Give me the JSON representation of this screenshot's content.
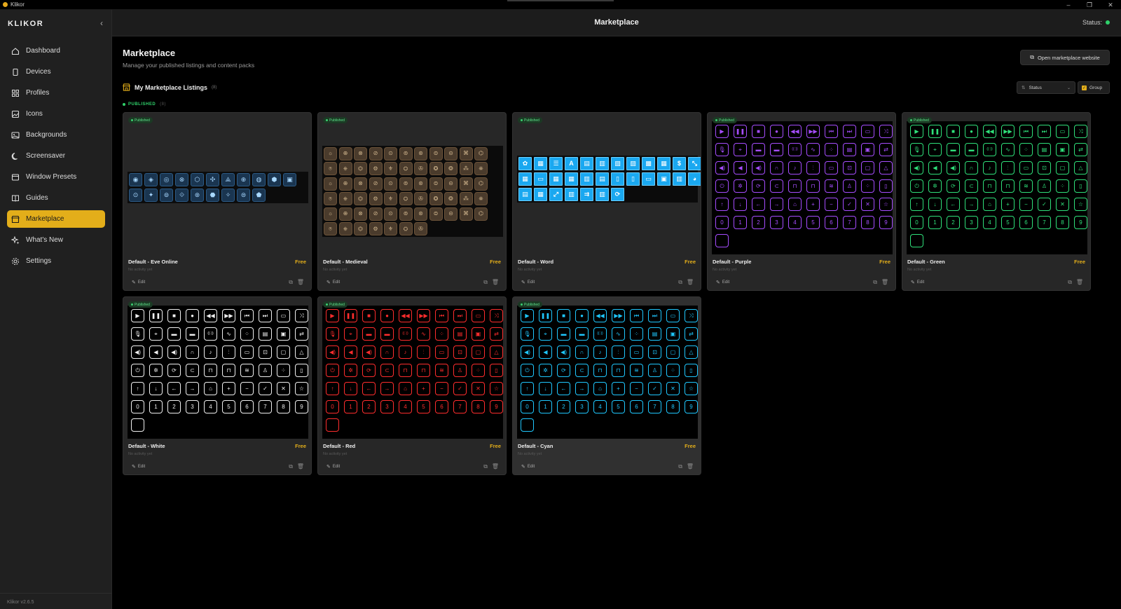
{
  "window": {
    "title": "Klikor",
    "controls": [
      "–",
      "❐",
      "✕"
    ]
  },
  "sidebar": {
    "brand": "KLIKOR",
    "version": "Klikor v2.6.5",
    "items": [
      {
        "label": "Dashboard",
        "icon": "home-icon"
      },
      {
        "label": "Devices",
        "icon": "device-icon"
      },
      {
        "label": "Profiles",
        "icon": "grid-icon"
      },
      {
        "label": "Icons",
        "icon": "image-icon"
      },
      {
        "label": "Backgrounds",
        "icon": "landscape-icon"
      },
      {
        "label": "Screensaver",
        "icon": "moon-icon"
      },
      {
        "label": "Window Presets",
        "icon": "window-icon"
      },
      {
        "label": "Guides",
        "icon": "book-icon"
      },
      {
        "label": "Marketplace",
        "icon": "store-icon",
        "active": true
      },
      {
        "label": "What's New",
        "icon": "sparkle-icon"
      },
      {
        "label": "Settings",
        "icon": "gear-icon"
      }
    ]
  },
  "header": {
    "title": "Marketplace",
    "status_label": "Status:",
    "status_color": "#2fd06a"
  },
  "page": {
    "title": "Marketplace",
    "subtitle": "Manage your published listings and content packs",
    "open_site_label": "Open marketplace website",
    "section_title": "My Marketplace Listings",
    "section_count": "(8)",
    "filter_label": "Status",
    "group_label": "Group",
    "group_heading": "PUBLISHED",
    "group_count": "(8)"
  },
  "accent_color": "#e3ae1a",
  "cards": [
    {
      "name": "Default - Eve Online",
      "price": "Free",
      "badge": "Published",
      "activity": "No activity yet",
      "edit": "Edit",
      "style": "eve"
    },
    {
      "name": "Default - Medieval",
      "price": "Free",
      "badge": "Published",
      "activity": "No activity yet",
      "edit": "Edit",
      "style": "med"
    },
    {
      "name": "Default - Word",
      "price": "Free",
      "badge": "Published",
      "activity": "No activity yet",
      "edit": "Edit",
      "style": "word"
    },
    {
      "name": "Default - Purple",
      "price": "Free",
      "badge": "Published",
      "activity": "No activity yet",
      "edit": "Edit",
      "style": "neon",
      "color": "#a64dff"
    },
    {
      "name": "Default - Green",
      "price": "Free",
      "badge": "Published",
      "activity": "No activity yet",
      "edit": "Edit",
      "style": "neon",
      "color": "#2fe07a"
    },
    {
      "name": "Default - White",
      "price": "Free",
      "badge": "Published",
      "activity": "No activity yet",
      "edit": "Edit",
      "style": "neon",
      "color": "#f0f0f0"
    },
    {
      "name": "Default - Red",
      "price": "Free",
      "badge": "Published",
      "activity": "No activity yet",
      "edit": "Edit",
      "style": "neon",
      "color": "#ff2d2d"
    },
    {
      "name": "Default - Cyan",
      "price": "Free",
      "badge": "Published",
      "activity": "No activity yet",
      "edit": "Edit",
      "style": "neon",
      "color": "#1fc8ff"
    }
  ]
}
